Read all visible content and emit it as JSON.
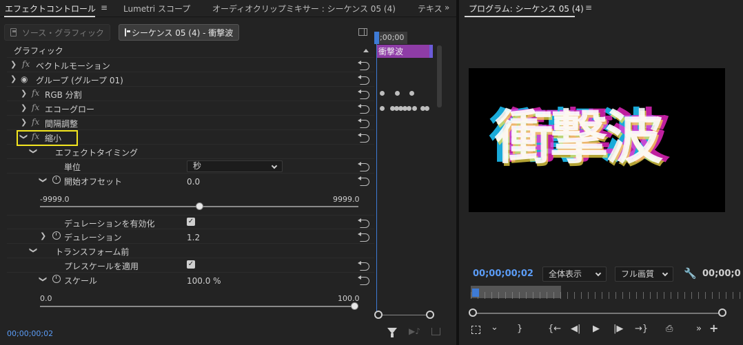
{
  "tabs": {
    "effect_controls": "エフェクトコントロール",
    "menu": "≡",
    "lumetri": "Lumetri スコープ",
    "audio_mixer": "オーディオクリップミキサー : シーケンス 05 (4)",
    "text": "テキス",
    "overflow": "»"
  },
  "effect_controls": {
    "source_button": "ソース・グラフィック",
    "sequence_button": "シーケンス 05 (4) - 衝撃波",
    "section_title": "グラフィック",
    "rows": {
      "vector_motion": "ベクトルモーション",
      "group": "グループ (グループ 01)",
      "rgb": "RGB 分割",
      "echo_glow": "エコーグロー",
      "spacing": "間隔調整",
      "shrink": "縮小",
      "effect_timing": "エフェクトタイミング",
      "unit": "単位",
      "start_offset": "開始オフセット",
      "duration_enable": "デュレーションを有効化",
      "duration": "デュレーション",
      "before_transform": "トランスフォーム前",
      "apply_prescale": "プレスケールを適用",
      "scale": "スケール"
    },
    "fx_label": "fx",
    "unit_value": "秒",
    "start_offset_value": "0.0",
    "start_offset_min": "-9999.0",
    "start_offset_max": "9999.0",
    "duration_value": "1.2",
    "scale_value": "100.0 %",
    "scale_min": "0.0",
    "scale_max": "100.0",
    "checkmark": "✓"
  },
  "mini_timeline": {
    "ruler_text": ";00;00",
    "clip_label": "衝撃波"
  },
  "bottom": {
    "timecode": "00;00;00;02",
    "audio_icon_glyph": "▶♪"
  },
  "program": {
    "title": "プログラム: シーケンス 05 (4)",
    "menu": "≡",
    "video_text": "衝撃波",
    "timecode": "00;00;00;02",
    "fit": "全体表示",
    "quality": "フル画質",
    "timecode_right": "00;00;0",
    "controls": {
      "marker": "⌗",
      "in": "{",
      "out": "}",
      "go_in": "{←",
      "step_back": "◀|",
      "play": "▶",
      "step_fwd": "|▶",
      "go_out": "→}",
      "export_frame": "⎙",
      "more": "»",
      "add": "+"
    }
  },
  "colors": {
    "accent_blue": "#5b9cf6",
    "clip_purple": "#8e3ca6",
    "highlight_yellow": "#f4e61e"
  }
}
